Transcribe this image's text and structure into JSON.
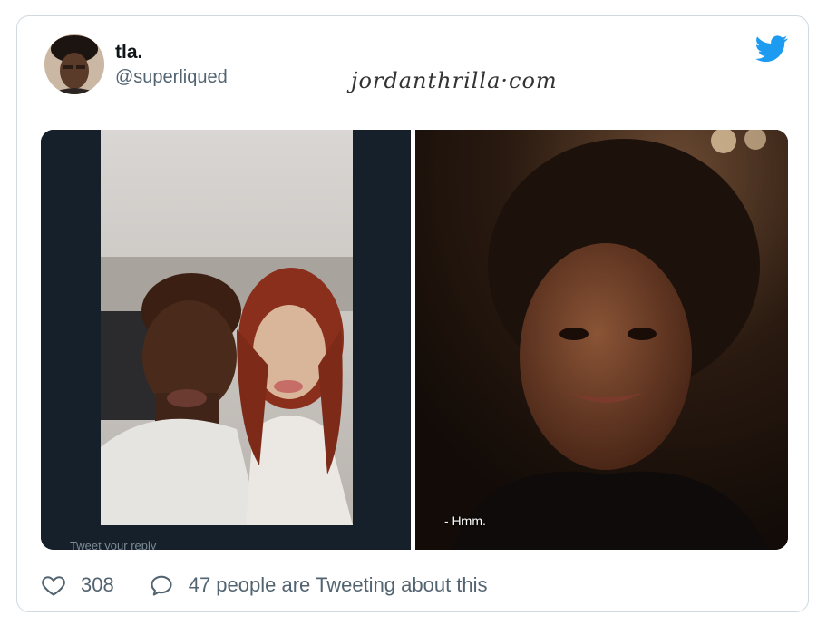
{
  "tweet": {
    "display_name": "tla.",
    "handle": "@superliqued",
    "watermark": "jordanthrilla·com",
    "likes": "308",
    "talking": "47 people are Tweeting about this"
  },
  "media": {
    "left_reply_placeholder": "Tweet your reply",
    "right_caption": "- Hmm."
  },
  "icons": {
    "brand": "twitter-bird-icon",
    "like": "heart-icon",
    "reply": "speech-bubble-icon"
  },
  "colors": {
    "brand_blue": "#1d9bf0",
    "muted_text": "#536471",
    "border": "#cfd9de"
  }
}
